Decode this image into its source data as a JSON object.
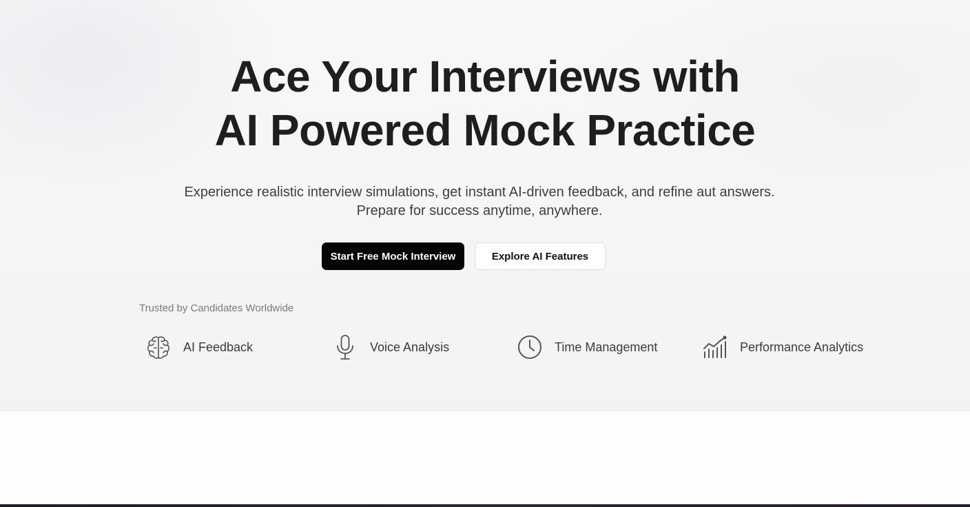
{
  "hero": {
    "title_line1": "Ace Your Interviews with",
    "title_line2": "AI Powered Mock Practice",
    "subtitle_line1": "Experience realistic interview simulations, get instant AI-driven feedback, and refine aut answers.",
    "subtitle_line2": "Prepare for success anytime, anywhere."
  },
  "cta": {
    "primary_label": "Start Free Mock Interview",
    "secondary_label": "Explore AI Features"
  },
  "trusted": {
    "label": "Trusted by Candidates Worldwide",
    "features": [
      {
        "icon": "brain-icon",
        "label": "AI Feedback"
      },
      {
        "icon": "microphone-icon",
        "label": "Voice Analysis"
      },
      {
        "icon": "clock-icon",
        "label": "Time Management"
      },
      {
        "icon": "bar-chart-trend-icon",
        "label": "Performance Analytics"
      }
    ]
  },
  "colors": {
    "primary_button_bg": "#050505",
    "primary_button_text": "#ffffff",
    "secondary_button_bg": "#ffffff",
    "heading_text": "#1e1e1e",
    "muted_text": "#7a7a7a",
    "icon_stroke": "#555555"
  }
}
